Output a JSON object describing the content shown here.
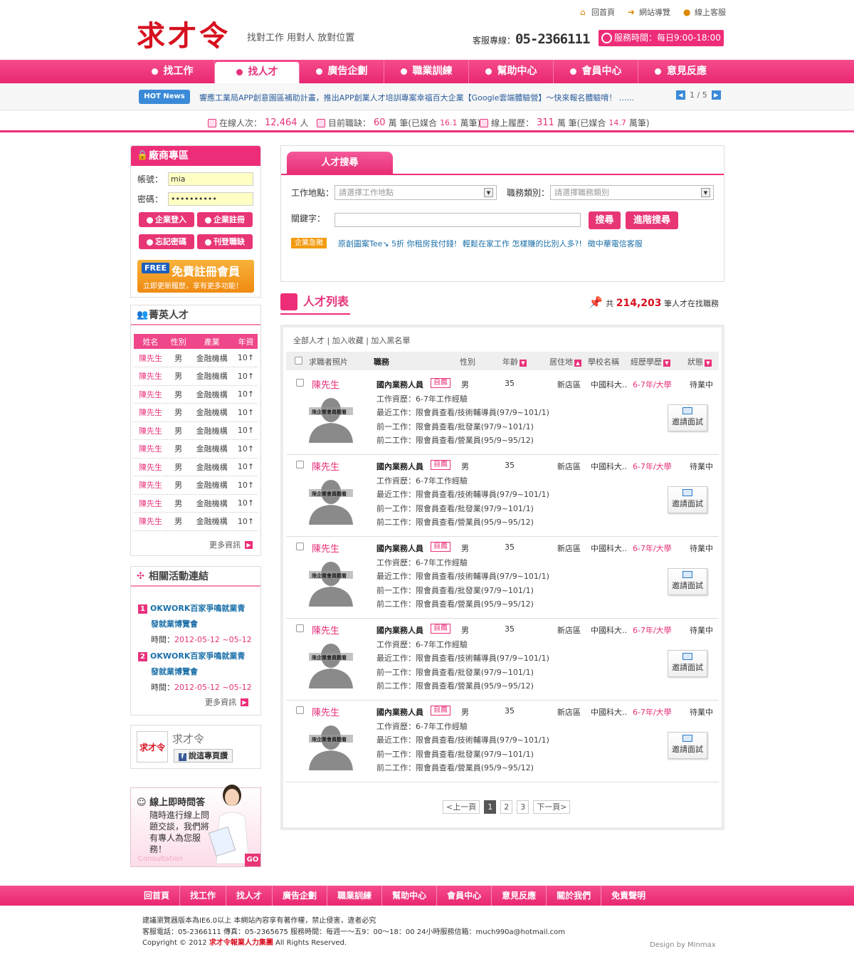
{
  "header": {
    "logo": "求才令",
    "slogan": "找對工作  用對人  放對位置",
    "top_links": [
      "回首頁",
      "網站導覽",
      "線上客服"
    ],
    "hotline_label": "客服專線：",
    "hotline_number": "05-2366111",
    "service_time": "服務時間：每日9:00-18:00"
  },
  "nav": {
    "items": [
      "找工作",
      "找人才",
      "廣告企劃",
      "職業訓練",
      "幫助中心",
      "會員中心",
      "意見反應"
    ],
    "active": "找人才"
  },
  "hot_news": {
    "badge": "HOT News",
    "text": "響應工業局APP創意園區補助計畫，推出APP創業人才培訓專案幸福百大企業【Google雲端體驗營】～快來報名體驗唷！ ......",
    "pager": "1 / 5"
  },
  "stats": {
    "online_label": "在線人次：",
    "online_value": "12,464",
    "online_unit": "人",
    "jobs_label": "目前職缺：",
    "jobs_value": "60",
    "jobs_unit": "萬 筆(已媒合",
    "jobs_matched": "16.1",
    "jobs_tail": "萬筆)",
    "resumes_label": "線上履歷：",
    "resumes_value": "311",
    "resumes_unit": "萬 筆(已媒合",
    "resumes_matched": "14.7",
    "resumes_tail": "萬筆)"
  },
  "login": {
    "title": "廠商專區",
    "account_label": "帳號：",
    "account_value": "mia",
    "password_label": "密碼：",
    "password_value": "••••••••••",
    "buttons": [
      "企業登入",
      "企業註冊",
      "忘記密碼",
      "刊登職缺"
    ],
    "free_badge": "FREE",
    "free_title": "免費註冊會員",
    "free_sub": "立即更新履歷，享有更多功能！"
  },
  "talent": {
    "title": "菁英人才",
    "headers": [
      "姓名",
      "性別",
      "產業",
      "年資"
    ],
    "rows": [
      [
        "陳先生",
        "男",
        "金融機構",
        "10↑"
      ],
      [
        "陳先生",
        "男",
        "金融機構",
        "10↑"
      ],
      [
        "陳先生",
        "男",
        "金融機構",
        "10↑"
      ],
      [
        "陳先生",
        "男",
        "金融機構",
        "10↑"
      ],
      [
        "陳先生",
        "男",
        "金融機構",
        "10↑"
      ],
      [
        "陳先生",
        "男",
        "金融機構",
        "10↑"
      ],
      [
        "陳先生",
        "男",
        "金融機構",
        "10↑"
      ],
      [
        "陳先生",
        "男",
        "金融機構",
        "10↑"
      ],
      [
        "陳先生",
        "男",
        "金融機構",
        "10↑"
      ],
      [
        "陳先生",
        "男",
        "金融機構",
        "10↑"
      ]
    ],
    "more": "更多資訊"
  },
  "activities": {
    "title": "相關活動連結",
    "items": [
      {
        "num": "1",
        "line1": "OKWORK百家爭鳴就業青",
        "line2": "發就業博覽會",
        "time_label": "時間：",
        "time": "2012-05-12 ~05-12"
      },
      {
        "num": "2",
        "line1": "OKWORK百家爭鳴就業青",
        "line2": "發就業博覽會",
        "time_label": "時間：",
        "time": "2012-05-12 ~05-12"
      }
    ],
    "more": "更多資訊"
  },
  "facebook": {
    "logo": "求才令",
    "name": "求才令",
    "like": "說這專頁讚"
  },
  "consult": {
    "title": "線上即時問答",
    "desc": "隨時進行線上問題交談，我們將有專人為您服務！",
    "label": "Consultation",
    "go": "GO"
  },
  "search": {
    "tab": "人才搜尋",
    "location_label": "工作地點：",
    "location_placeholder": "請選擇工作地點",
    "category_label": "職務類別：",
    "category_placeholder": "請選擇職務類別",
    "keyword_label": "關鍵字：",
    "search_button": "搜尋",
    "advanced_button": "進階搜尋",
    "urgent_badge": "企業急徵",
    "urgent_links": [
      "原創圖案Tee↘ 5折 你租房我付錢!",
      "輕鬆在家工作 怎樣賺的比別人多?!",
      "徵中華電信客服"
    ]
  },
  "list": {
    "title": "人才列表",
    "count_prefix": "共",
    "count": "214,203",
    "count_suffix": "筆人才在找職務",
    "options": "全部人才  |  加入收藏  |  加入黑名單",
    "columns": [
      "求職者照片",
      "職務",
      "性別",
      "年齡",
      "居住地",
      "學校名稱",
      "經歷學歷",
      "狀態"
    ],
    "rows": [
      {
        "name": "陳先生",
        "job": "國內業務人員",
        "tag": "自薦",
        "sex": "男",
        "age": "35",
        "area": "新店區",
        "school": "中國科大..",
        "exp": "6-7年/大學",
        "status": "待業中",
        "photo_note": "限企業會員觀看",
        "lines": [
          "工作資歷：6-7年工作經驗",
          "最近工作：限會員查看/技術輔導員(97/9~101/1)",
          "前一工作：限會員查看/批發業(97/9~101/1)",
          "前二工作：限會員查看/營業員(95/9~95/12)"
        ],
        "invite": "邀請面試"
      },
      {
        "name": "陳先生",
        "job": "國內業務人員",
        "tag": "自薦",
        "sex": "男",
        "age": "35",
        "area": "新店區",
        "school": "中國科大..",
        "exp": "6-7年/大學",
        "status": "待業中",
        "photo_note": "限企業會員觀看",
        "lines": [
          "工作資歷：6-7年工作經驗",
          "最近工作：限會員查看/技術輔導員(97/9~101/1)",
          "前一工作：限會員查看/批發業(97/9~101/1)",
          "前二工作：限會員查看/營業員(95/9~95/12)"
        ],
        "invite": "邀請面試"
      },
      {
        "name": "陳先生",
        "job": "國內業務人員",
        "tag": "自薦",
        "sex": "男",
        "age": "35",
        "area": "新店區",
        "school": "中國科大..",
        "exp": "6-7年/大學",
        "status": "待業中",
        "photo_note": "限企業會員觀看",
        "lines": [
          "工作資歷：6-7年工作經驗",
          "最近工作：限會員查看/技術輔導員(97/9~101/1)",
          "前一工作：限會員查看/批發業(97/9~101/1)",
          "前二工作：限會員查看/營業員(95/9~95/12)"
        ],
        "invite": "邀請面試"
      },
      {
        "name": "陳先生",
        "job": "國內業務人員",
        "tag": "自薦",
        "sex": "男",
        "age": "35",
        "area": "新店區",
        "school": "中國科大..",
        "exp": "6-7年/大學",
        "status": "待業中",
        "photo_note": "限企業會員觀看",
        "lines": [
          "工作資歷：6-7年工作經驗",
          "最近工作：限會員查看/技術輔導員(97/9~101/1)",
          "前一工作：限會員查看/批發業(97/9~101/1)",
          "前二工作：限會員查看/營業員(95/9~95/12)"
        ],
        "invite": "邀請面試"
      },
      {
        "name": "陳先生",
        "job": "國內業務人員",
        "tag": "自薦",
        "sex": "男",
        "age": "35",
        "area": "新店區",
        "school": "中國科大..",
        "exp": "6-7年/大學",
        "status": "待業中",
        "photo_note": "限企業會員觀看",
        "lines": [
          "工作資歷：6-7年工作經驗",
          "最近工作：限會員查看/技術輔導員(97/9~101/1)",
          "前一工作：限會員查看/批發業(97/9~101/1)",
          "前二工作：限會員查看/營業員(95/9~95/12)"
        ],
        "invite": "邀請面試"
      }
    ],
    "pager": [
      "<上一頁",
      "1",
      "2",
      "3",
      "下一頁>"
    ]
  },
  "footer": {
    "nav": [
      "回首頁",
      "找工作",
      "找人才",
      "廣告企劃",
      "職業訓練",
      "幫助中心",
      "會員中心",
      "意見反應",
      "關於我們",
      "免責聲明"
    ],
    "line1": "建議瀏覽器版本為IE6.0以上 本網站內容享有著作權，禁止侵害，違者必究",
    "line2": "客服電話：05-2366111   傳真：05-2365675   服務時間：每週一～五9：00～18：00    24小時服務信箱：much990a@hotmail.com",
    "copyright_pre": "Copyright © 2012 ",
    "copyright_brand": "求才令報業人力集團",
    "copyright_post": " All Rights Reserved.",
    "design": "Design by Minmax"
  },
  "colors": {
    "brand_pink": "#ee2d78",
    "logo_red": "#d7101f",
    "link_blue": "#1a6fa9"
  }
}
